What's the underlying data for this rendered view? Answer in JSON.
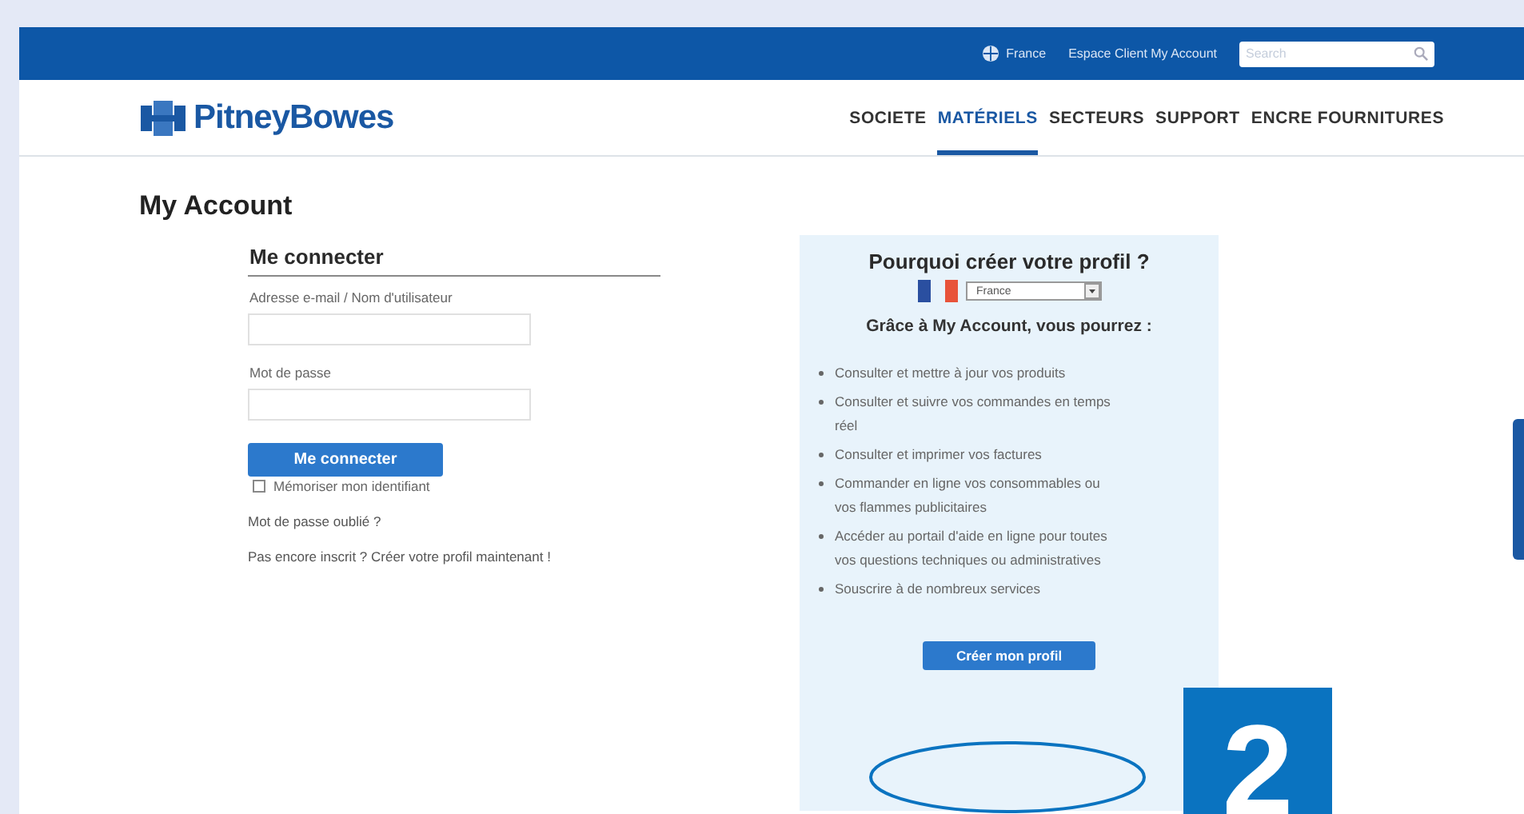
{
  "top_bar": {
    "country": "France",
    "account_link": "Espace Client My Account",
    "search": {
      "placeholder": "Search"
    }
  },
  "header": {
    "logo": "PitneyBowes",
    "nav": [
      {
        "label": "SOCIETE",
        "selected": false
      },
      {
        "label": "MATÉRIELS",
        "selected": true
      },
      {
        "label": "SECTEURS",
        "selected": false
      },
      {
        "label": "SUPPORT",
        "selected": false
      },
      {
        "label": "ENCRE FOURNITURES",
        "selected": false
      }
    ]
  },
  "page_title": "My Account",
  "login": {
    "title": "Me connecter",
    "email_label": "Adresse e-mail / Nom d'utilisateur",
    "password_label": "Mot de passe",
    "submit": "Me connecter",
    "remember": {
      "label": "Mémoriser mon identifiant",
      "checked": false
    },
    "forgot": "Mot de passe oublié ?",
    "register": "Pas encore inscrit ? Créer votre profil maintenant !"
  },
  "profile_panel": {
    "title": "Pourquoi créer votre profil ?",
    "country": "France",
    "intro": "Grâce à My Account, vous pourrez :",
    "benefits": [
      "Consulter et mettre à jour vos produits",
      "Consulter et suivre vos commandes en temps réel",
      "Consulter et imprimer vos factures",
      "Commander en ligne vos consommables ou vos flammes publicitaires",
      "Accéder au portail d'aide en ligne pour toutes vos questions techniques ou administratives",
      "Souscrire à de nombreux services"
    ],
    "button": "Créer mon profil"
  },
  "step_badge": "2"
}
